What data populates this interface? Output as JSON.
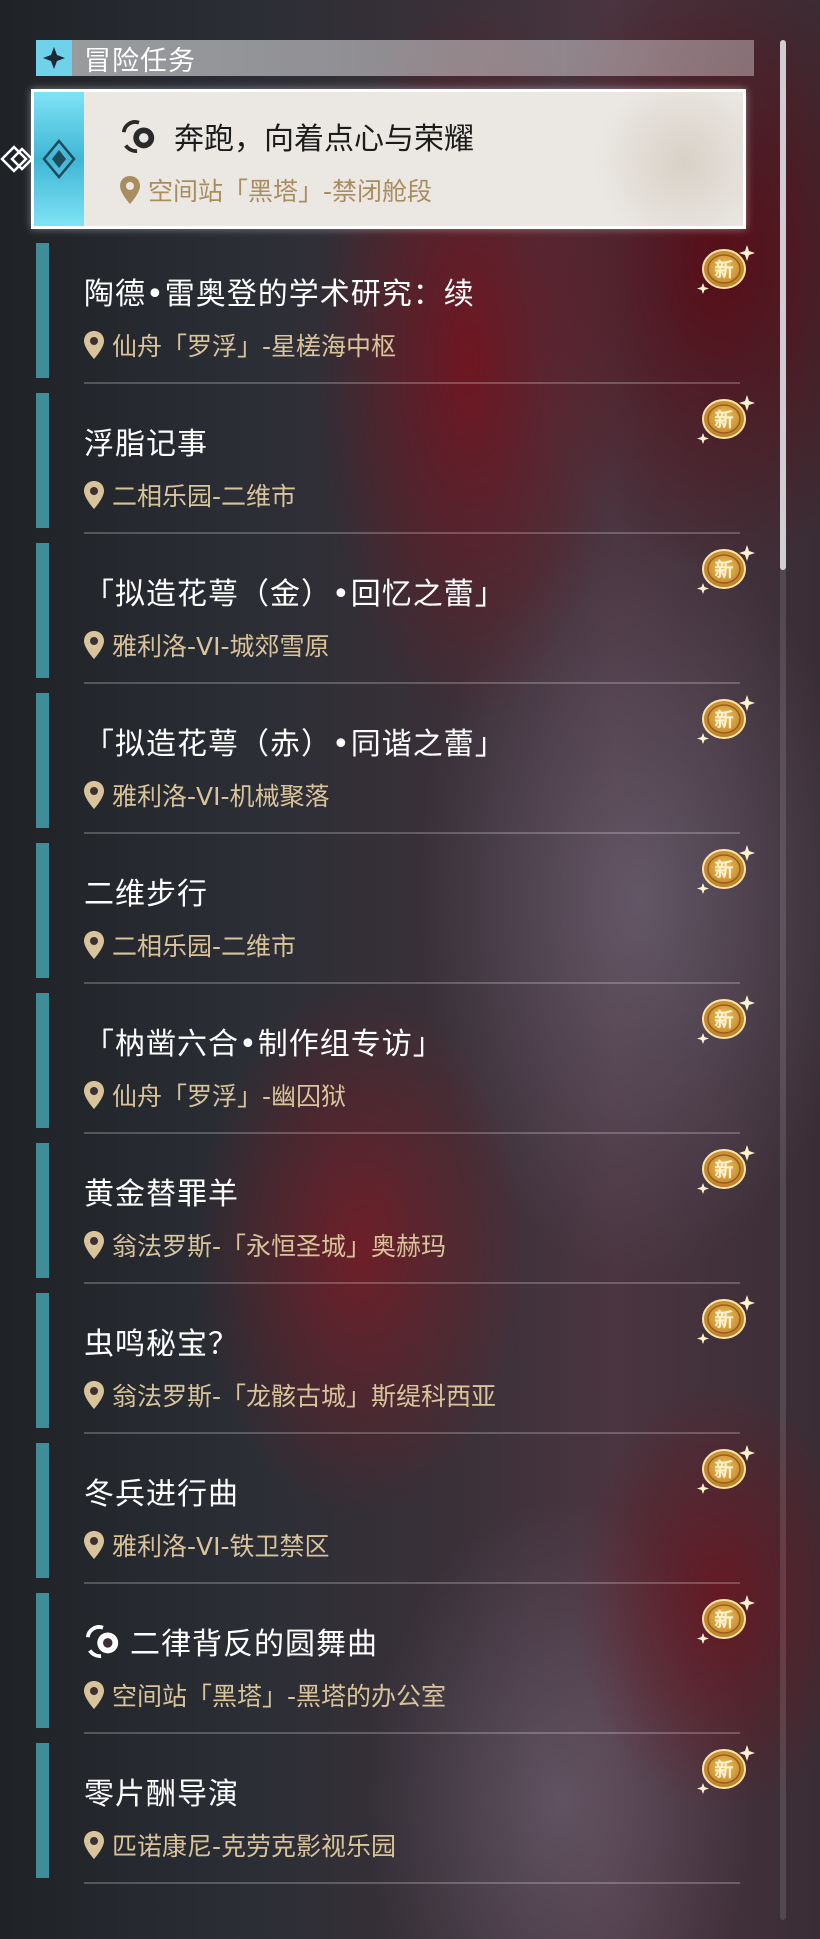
{
  "panel": {
    "title": "冒险任务"
  },
  "selected_quest": {
    "title": "奔跑，向着点心与荣耀",
    "location": "空间站「黑塔」-禁闭舱段",
    "has_trailblaze_icon": true
  },
  "badge_label": "新",
  "quests": [
    {
      "title": "陶德•雷奥登的学术研究：续",
      "location": "仙舟「罗浮」-星槎海中枢",
      "has_trailblaze_icon": false
    },
    {
      "title": "浮脂记事",
      "location": "二相乐园-二维市",
      "has_trailblaze_icon": false
    },
    {
      "title": "「拟造花萼（金）•回忆之蕾」",
      "location": "雅利洛-VI-城郊雪原",
      "has_trailblaze_icon": false
    },
    {
      "title": "「拟造花萼（赤）•同谐之蕾」",
      "location": "雅利洛-VI-机械聚落",
      "has_trailblaze_icon": false
    },
    {
      "title": "二维步行",
      "location": "二相乐园-二维市",
      "has_trailblaze_icon": false
    },
    {
      "title": "「枘凿六合•制作组专访」",
      "location": "仙舟「罗浮」-幽囚狱",
      "has_trailblaze_icon": false
    },
    {
      "title": "黄金替罪羊",
      "location": "翁法罗斯-「永恒圣城」奥赫玛",
      "has_trailblaze_icon": false
    },
    {
      "title": "虫鸣秘宝？",
      "location": "翁法罗斯-「龙骸古城」斯缇科西亚",
      "has_trailblaze_icon": false
    },
    {
      "title": "冬兵进行曲",
      "location": "雅利洛-VI-铁卫禁区",
      "has_trailblaze_icon": false
    },
    {
      "title": "二律背反的圆舞曲",
      "location": "空间站「黑塔」-黑塔的办公室",
      "has_trailblaze_icon": true
    },
    {
      "title": "零片酬导演",
      "location": "匹诺康尼-克劳克影视乐园",
      "has_trailblaze_icon": false
    }
  ],
  "colors": {
    "accent_cyan": "#6fd2ea",
    "item_bar": "#3f8d98",
    "location_gold": "#d8c39a",
    "badge_gold": "#e3a43a"
  },
  "icons": {
    "header": "diamond-star-icon",
    "location": "location-pin-icon",
    "badge": "new-badge-icon",
    "trailblaze": "trailblaze-mission-icon"
  }
}
